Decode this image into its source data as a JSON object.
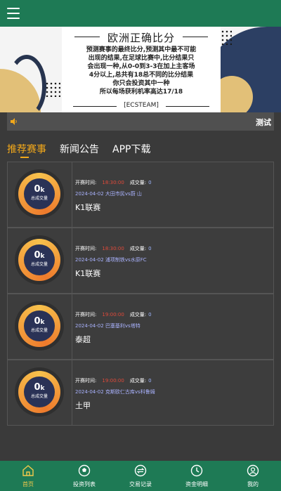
{
  "header": {
    "menu_icon": "hamburger-menu-icon"
  },
  "banner": {
    "title": "欧洲正确比分",
    "lines": [
      "预测赛事的最终比分,预测其中最不可能",
      "出现的结果,在足球比赛中,比分结果只",
      "会出现一种,从0-0到3-3在加上主客场",
      "4分以上,总共有18总不同的比分结果",
      "你只会投资其中一种",
      "所以每场获利机率高达17/18"
    ],
    "footer": "[ECSTEAM]",
    "colors": {
      "navy": "#2c3f63",
      "gold": "#e2c078"
    }
  },
  "notice": {
    "icon": "speaker-icon",
    "text": "测试"
  },
  "tabs": [
    {
      "label": "推荐赛事",
      "active": true
    },
    {
      "label": "新闻公告",
      "active": false
    },
    {
      "label": "APP下载",
      "active": false
    }
  ],
  "matches": [
    {
      "volume": "0",
      "volume_unit": "k",
      "volume_label": "总成交量",
      "open_label": "开赛时间:",
      "open_time": "18:30:00",
      "deal_label": "成交量:",
      "deal_value": "0",
      "date_teams": "2024-04-02 大田市民vs蔚 山",
      "league": "K1联赛"
    },
    {
      "volume": "0",
      "volume_unit": "k",
      "volume_label": "总成交量",
      "open_label": "开赛时间:",
      "open_time": "18:30:00",
      "deal_label": "成交量:",
      "deal_value": "0",
      "date_teams": "2024-04-02 浦项制铁vs水原FC",
      "league": "K1联赛"
    },
    {
      "volume": "0",
      "volume_unit": "k",
      "volume_label": "总成交量",
      "open_label": "开赛时间:",
      "open_time": "19:00:00",
      "deal_label": "成交量:",
      "deal_value": "0",
      "date_teams": "2024-04-02 巴塞基利vs塔特",
      "league": "泰超"
    },
    {
      "volume": "0",
      "volume_unit": "k",
      "volume_label": "总成交量",
      "open_label": "开赛时间:",
      "open_time": "19:00:00",
      "deal_label": "成交量:",
      "deal_value": "0",
      "date_teams": "2024-04-02 克斯欧仁古库vs科鲁姆",
      "league": "土甲"
    }
  ],
  "nav": [
    {
      "label": "首页",
      "icon": "home-icon",
      "active": true
    },
    {
      "label": "投资列表",
      "icon": "football-icon",
      "active": false
    },
    {
      "label": "交易记录",
      "icon": "exchange-icon",
      "active": false
    },
    {
      "label": "资金明细",
      "icon": "clock-icon",
      "active": false
    },
    {
      "label": "我的",
      "icon": "user-icon",
      "active": false
    }
  ],
  "colors": {
    "header_bg": "#1e7a55",
    "accent": "#f2a81a",
    "page_bg": "#3a3a3a"
  }
}
